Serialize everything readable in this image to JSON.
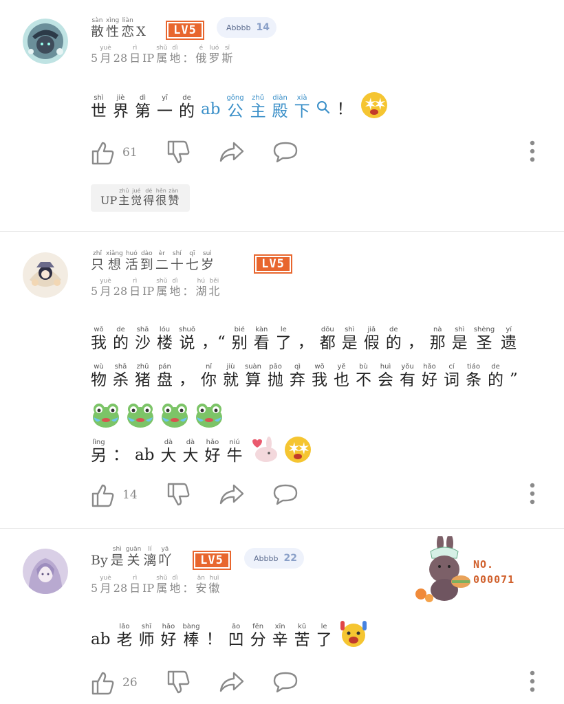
{
  "comments": [
    {
      "username": [
        {
          "hz": "散",
          "py": "sàn"
        },
        {
          "hz": "性",
          "py": "xìng"
        },
        {
          "hz": "恋",
          "py": "liàn"
        },
        {
          "text": "X"
        }
      ],
      "level": "LV5",
      "fan_badge": {
        "name": "Abbbb",
        "level": "14"
      },
      "meta": [
        {
          "text": "5"
        },
        {
          "hz": "月",
          "py": "yuè"
        },
        {
          "text": "28"
        },
        {
          "hz": "日",
          "py": "rì"
        },
        {
          "text": "IP"
        },
        {
          "hz": "属",
          "py": "shǔ"
        },
        {
          "hz": "地",
          "py": "dì"
        },
        {
          "text": "："
        },
        {
          "hz": "俄",
          "py": "é"
        },
        {
          "hz": "罗",
          "py": "luó"
        },
        {
          "hz": "斯",
          "py": "sī"
        }
      ],
      "lines": [
        [
          {
            "hz": "世",
            "py": "shì"
          },
          {
            "hz": "界",
            "py": "jiè"
          },
          {
            "hz": "第",
            "py": "dì"
          },
          {
            "hz": "一",
            "py": "yī"
          },
          {
            "hz": "的",
            "py": "de"
          },
          {
            "text": "ab",
            "link": true
          },
          {
            "hz": "公",
            "py": "gōng",
            "link": true
          },
          {
            "hz": "主",
            "py": "zhǔ",
            "link": true
          },
          {
            "hz": "殿",
            "py": "diàn",
            "link": true
          },
          {
            "hz": "下",
            "py": "xià",
            "link": true
          },
          {
            "icon": "search-icon"
          },
          {
            "text": "！"
          },
          {
            "emoji": "starry-eyes-emoji"
          }
        ]
      ],
      "likes": "61",
      "reply_tag": [
        {
          "text": "UP"
        },
        {
          "hz": "主",
          "py": "zhǔ"
        },
        {
          "hz": "觉",
          "py": "jué"
        },
        {
          "hz": "得",
          "py": "dé"
        },
        {
          "hz": "很",
          "py": "hěn"
        },
        {
          "hz": "赞",
          "py": "zàn"
        }
      ]
    },
    {
      "username": [
        {
          "hz": "只",
          "py": "zhǐ"
        },
        {
          "hz": "想",
          "py": "xiǎng"
        },
        {
          "hz": "活",
          "py": "huó"
        },
        {
          "hz": "到",
          "py": "dào"
        },
        {
          "hz": "二",
          "py": "èr"
        },
        {
          "hz": "十",
          "py": "shí"
        },
        {
          "hz": "七",
          "py": "qī"
        },
        {
          "hz": "岁",
          "py": "suì"
        }
      ],
      "level": "LV5",
      "meta": [
        {
          "text": "5"
        },
        {
          "hz": "月",
          "py": "yuè"
        },
        {
          "text": "28"
        },
        {
          "hz": "日",
          "py": "rì"
        },
        {
          "text": "IP"
        },
        {
          "hz": "属",
          "py": "shǔ"
        },
        {
          "hz": "地",
          "py": "dì"
        },
        {
          "text": "："
        },
        {
          "hz": "湖",
          "py": "hú"
        },
        {
          "hz": "北",
          "py": "běi"
        }
      ],
      "lines": [
        [
          {
            "hz": "我",
            "py": "wǒ"
          },
          {
            "hz": "的",
            "py": "de"
          },
          {
            "hz": "沙",
            "py": "shā"
          },
          {
            "hz": "楼",
            "py": "lóu"
          },
          {
            "hz": "说",
            "py": "shuō"
          },
          {
            "text": "，“"
          },
          {
            "hz": "别",
            "py": "bié"
          },
          {
            "hz": "看",
            "py": "kàn"
          },
          {
            "hz": "了",
            "py": "le"
          },
          {
            "text": "，"
          },
          {
            "hz": "都",
            "py": "dōu"
          },
          {
            "hz": "是",
            "py": "shì"
          },
          {
            "hz": "假",
            "py": "jiǎ"
          },
          {
            "hz": "的",
            "py": "de"
          },
          {
            "text": "，"
          },
          {
            "hz": "那",
            "py": "nà"
          },
          {
            "hz": "是",
            "py": "shì"
          },
          {
            "hz": "圣",
            "py": "shèng"
          },
          {
            "hz": "遗",
            "py": "yí"
          }
        ],
        [
          {
            "hz": "物",
            "py": "wù"
          },
          {
            "hz": "杀",
            "py": "shā"
          },
          {
            "hz": "猪",
            "py": "zhū"
          },
          {
            "hz": "盘",
            "py": "pán"
          },
          {
            "text": "，"
          },
          {
            "hz": "你",
            "py": "nǐ"
          },
          {
            "hz": "就",
            "py": "jiù"
          },
          {
            "hz": "算",
            "py": "suàn"
          },
          {
            "hz": "抛",
            "py": "pāo"
          },
          {
            "hz": "弃",
            "py": "qì"
          },
          {
            "hz": "我",
            "py": "wǒ"
          },
          {
            "hz": "也",
            "py": "yě"
          },
          {
            "hz": "不",
            "py": "bù"
          },
          {
            "hz": "会",
            "py": "huì"
          },
          {
            "hz": "有",
            "py": "yǒu"
          },
          {
            "hz": "好",
            "py": "hǎo"
          },
          {
            "hz": "词",
            "py": "cí"
          },
          {
            "hz": "条",
            "py": "tiáo"
          },
          {
            "hz": "的",
            "py": "de"
          },
          {
            "text": "”"
          }
        ],
        [
          {
            "emoji": "crying-frog-emoji"
          },
          {
            "emoji": "crying-frog-emoji"
          },
          {
            "emoji": "crying-frog-emoji"
          },
          {
            "emoji": "crying-frog-emoji"
          }
        ],
        [
          {
            "hz": "另",
            "py": "lìng"
          },
          {
            "text": "："
          },
          {
            "text": "ab"
          },
          {
            "hz": "大",
            "py": "dà"
          },
          {
            "hz": "大",
            "py": "dà"
          },
          {
            "hz": "好",
            "py": "hǎo"
          },
          {
            "hz": "牛",
            "py": "niú"
          },
          {
            "emoji": "bunny-heart-emoji"
          },
          {
            "emoji": "starry-eyes-emoji"
          }
        ]
      ],
      "likes": "14"
    },
    {
      "username": [
        {
          "text": "By"
        },
        {
          "hz": "是",
          "py": "shì"
        },
        {
          "hz": "关",
          "py": "guān"
        },
        {
          "hz": "漓",
          "py": "lí"
        },
        {
          "hz": "吖",
          "py": "yā"
        }
      ],
      "level": "LV5",
      "fan_badge": {
        "name": "Abbbb",
        "level": "22"
      },
      "meta": [
        {
          "text": "5"
        },
        {
          "hz": "月",
          "py": "yuè"
        },
        {
          "text": "28"
        },
        {
          "hz": "日",
          "py": "rì"
        },
        {
          "text": "IP"
        },
        {
          "hz": "属",
          "py": "shǔ"
        },
        {
          "hz": "地",
          "py": "dì"
        },
        {
          "text": "："
        },
        {
          "hz": "安",
          "py": "ān"
        },
        {
          "hz": "徽",
          "py": "huī"
        }
      ],
      "lines": [
        [
          {
            "text": "ab"
          },
          {
            "hz": "老",
            "py": "lǎo"
          },
          {
            "hz": "师",
            "py": "shī"
          },
          {
            "hz": "好",
            "py": "hǎo"
          },
          {
            "hz": "棒",
            "py": "bàng"
          },
          {
            "text": "！"
          },
          {
            "hz": "凹",
            "py": "āo"
          },
          {
            "hz": "分",
            "py": "fēn"
          },
          {
            "hz": "辛",
            "py": "xīn"
          },
          {
            "hz": "苦",
            "py": "kǔ"
          },
          {
            "hz": "了",
            "py": "le"
          },
          {
            "emoji": "cheering-emoji"
          }
        ]
      ],
      "likes": "26",
      "decoration": {
        "label": "NO.",
        "number": "000071"
      }
    }
  ],
  "colors": {
    "level_badge": "#e8662e",
    "link": "#3a8fc8",
    "fan_badge_bg": "#eef2fb",
    "icon": "#8a8a8a"
  }
}
